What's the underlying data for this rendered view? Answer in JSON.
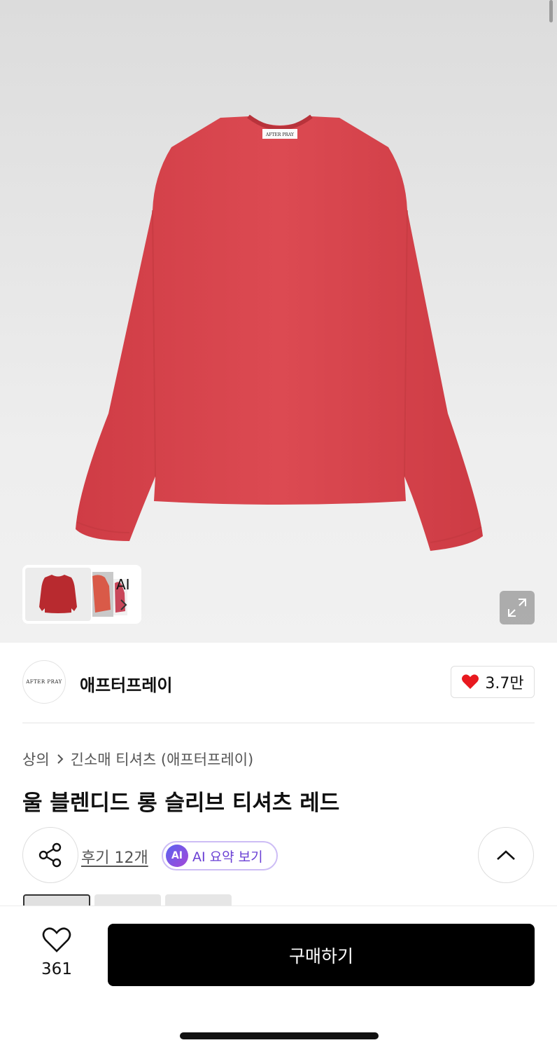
{
  "gallery": {
    "shirt_label": "AFTER PRAY",
    "ai_thumb_label": "AI"
  },
  "brand": {
    "logo_text": "AFTER PRAY",
    "name": "애프터프레이",
    "like_count": "3.7만"
  },
  "breadcrumb": {
    "category": "상의",
    "subcategory": "긴소매 티셔츠 (애프터프레이)"
  },
  "product": {
    "title": "울 블렌디드 롱 슬리브 티셔츠 레드",
    "reviews_label": "후기 12개",
    "ai_badge": "AI",
    "ai_summary_label": "AI 요약 보기"
  },
  "bottom_bar": {
    "wish_count": "361",
    "buy_label": "구매하기"
  },
  "colors": {
    "product_red": "#d9454d",
    "buy_button": "#000000",
    "ai_purple": "#6a3fd4",
    "heart_red": "#e8191f"
  },
  "icons": [
    "share-icon",
    "chevron-up-icon",
    "heart-icon",
    "heart-outline-icon",
    "expand-icon",
    "chevron-right-icon"
  ]
}
